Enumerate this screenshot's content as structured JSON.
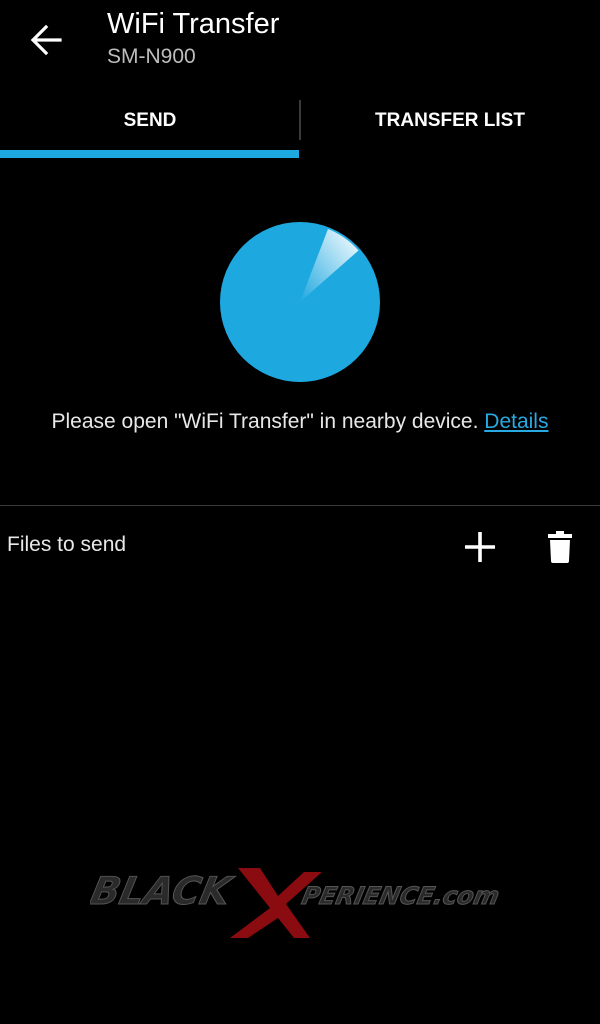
{
  "header": {
    "back_icon": "arrow-left-icon",
    "title": "WiFi Transfer",
    "subtitle": "SM-N900"
  },
  "tabs": [
    {
      "label": "SEND",
      "active": true
    },
    {
      "label": "TRANSFER LIST",
      "active": false
    }
  ],
  "radar": {
    "icon": "radar-scan-icon",
    "color": "#1ea8e0"
  },
  "message": {
    "text": "Please open \"WiFi Transfer\" in nearby device. ",
    "link_label": "Details"
  },
  "files": {
    "label": "Files to send",
    "add_icon": "plus-icon",
    "delete_icon": "trash-icon"
  },
  "watermark": {
    "text": "BLACKXPERIENCE.com"
  },
  "colors": {
    "accent": "#1ea8e0",
    "background": "#000000"
  }
}
